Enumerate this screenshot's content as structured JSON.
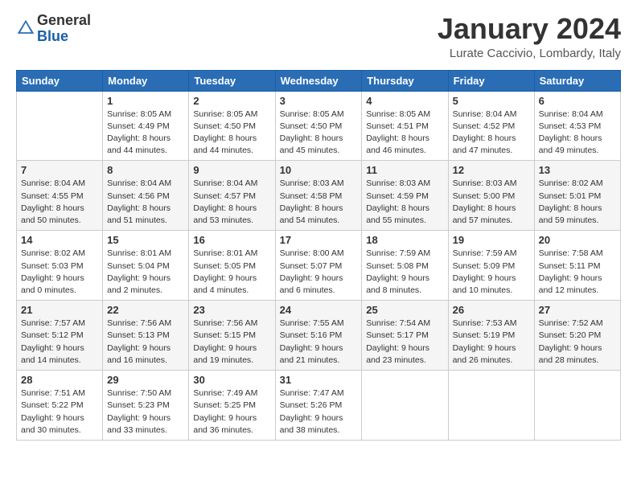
{
  "header": {
    "logo_general": "General",
    "logo_blue": "Blue",
    "month_title": "January 2024",
    "location": "Lurate Caccivio, Lombardy, Italy"
  },
  "days_of_week": [
    "Sunday",
    "Monday",
    "Tuesday",
    "Wednesday",
    "Thursday",
    "Friday",
    "Saturday"
  ],
  "weeks": [
    [
      {
        "day": "",
        "info": ""
      },
      {
        "day": "1",
        "info": "Sunrise: 8:05 AM\nSunset: 4:49 PM\nDaylight: 8 hours\nand 44 minutes."
      },
      {
        "day": "2",
        "info": "Sunrise: 8:05 AM\nSunset: 4:50 PM\nDaylight: 8 hours\nand 44 minutes."
      },
      {
        "day": "3",
        "info": "Sunrise: 8:05 AM\nSunset: 4:50 PM\nDaylight: 8 hours\nand 45 minutes."
      },
      {
        "day": "4",
        "info": "Sunrise: 8:05 AM\nSunset: 4:51 PM\nDaylight: 8 hours\nand 46 minutes."
      },
      {
        "day": "5",
        "info": "Sunrise: 8:04 AM\nSunset: 4:52 PM\nDaylight: 8 hours\nand 47 minutes."
      },
      {
        "day": "6",
        "info": "Sunrise: 8:04 AM\nSunset: 4:53 PM\nDaylight: 8 hours\nand 49 minutes."
      }
    ],
    [
      {
        "day": "7",
        "info": "Sunrise: 8:04 AM\nSunset: 4:55 PM\nDaylight: 8 hours\nand 50 minutes."
      },
      {
        "day": "8",
        "info": "Sunrise: 8:04 AM\nSunset: 4:56 PM\nDaylight: 8 hours\nand 51 minutes."
      },
      {
        "day": "9",
        "info": "Sunrise: 8:04 AM\nSunset: 4:57 PM\nDaylight: 8 hours\nand 53 minutes."
      },
      {
        "day": "10",
        "info": "Sunrise: 8:03 AM\nSunset: 4:58 PM\nDaylight: 8 hours\nand 54 minutes."
      },
      {
        "day": "11",
        "info": "Sunrise: 8:03 AM\nSunset: 4:59 PM\nDaylight: 8 hours\nand 55 minutes."
      },
      {
        "day": "12",
        "info": "Sunrise: 8:03 AM\nSunset: 5:00 PM\nDaylight: 8 hours\nand 57 minutes."
      },
      {
        "day": "13",
        "info": "Sunrise: 8:02 AM\nSunset: 5:01 PM\nDaylight: 8 hours\nand 59 minutes."
      }
    ],
    [
      {
        "day": "14",
        "info": "Sunrise: 8:02 AM\nSunset: 5:03 PM\nDaylight: 9 hours\nand 0 minutes."
      },
      {
        "day": "15",
        "info": "Sunrise: 8:01 AM\nSunset: 5:04 PM\nDaylight: 9 hours\nand 2 minutes."
      },
      {
        "day": "16",
        "info": "Sunrise: 8:01 AM\nSunset: 5:05 PM\nDaylight: 9 hours\nand 4 minutes."
      },
      {
        "day": "17",
        "info": "Sunrise: 8:00 AM\nSunset: 5:07 PM\nDaylight: 9 hours\nand 6 minutes."
      },
      {
        "day": "18",
        "info": "Sunrise: 7:59 AM\nSunset: 5:08 PM\nDaylight: 9 hours\nand 8 minutes."
      },
      {
        "day": "19",
        "info": "Sunrise: 7:59 AM\nSunset: 5:09 PM\nDaylight: 9 hours\nand 10 minutes."
      },
      {
        "day": "20",
        "info": "Sunrise: 7:58 AM\nSunset: 5:11 PM\nDaylight: 9 hours\nand 12 minutes."
      }
    ],
    [
      {
        "day": "21",
        "info": "Sunrise: 7:57 AM\nSunset: 5:12 PM\nDaylight: 9 hours\nand 14 minutes."
      },
      {
        "day": "22",
        "info": "Sunrise: 7:56 AM\nSunset: 5:13 PM\nDaylight: 9 hours\nand 16 minutes."
      },
      {
        "day": "23",
        "info": "Sunrise: 7:56 AM\nSunset: 5:15 PM\nDaylight: 9 hours\nand 19 minutes."
      },
      {
        "day": "24",
        "info": "Sunrise: 7:55 AM\nSunset: 5:16 PM\nDaylight: 9 hours\nand 21 minutes."
      },
      {
        "day": "25",
        "info": "Sunrise: 7:54 AM\nSunset: 5:17 PM\nDaylight: 9 hours\nand 23 minutes."
      },
      {
        "day": "26",
        "info": "Sunrise: 7:53 AM\nSunset: 5:19 PM\nDaylight: 9 hours\nand 26 minutes."
      },
      {
        "day": "27",
        "info": "Sunrise: 7:52 AM\nSunset: 5:20 PM\nDaylight: 9 hours\nand 28 minutes."
      }
    ],
    [
      {
        "day": "28",
        "info": "Sunrise: 7:51 AM\nSunset: 5:22 PM\nDaylight: 9 hours\nand 30 minutes."
      },
      {
        "day": "29",
        "info": "Sunrise: 7:50 AM\nSunset: 5:23 PM\nDaylight: 9 hours\nand 33 minutes."
      },
      {
        "day": "30",
        "info": "Sunrise: 7:49 AM\nSunset: 5:25 PM\nDaylight: 9 hours\nand 36 minutes."
      },
      {
        "day": "31",
        "info": "Sunrise: 7:47 AM\nSunset: 5:26 PM\nDaylight: 9 hours\nand 38 minutes."
      },
      {
        "day": "",
        "info": ""
      },
      {
        "day": "",
        "info": ""
      },
      {
        "day": "",
        "info": ""
      }
    ]
  ]
}
